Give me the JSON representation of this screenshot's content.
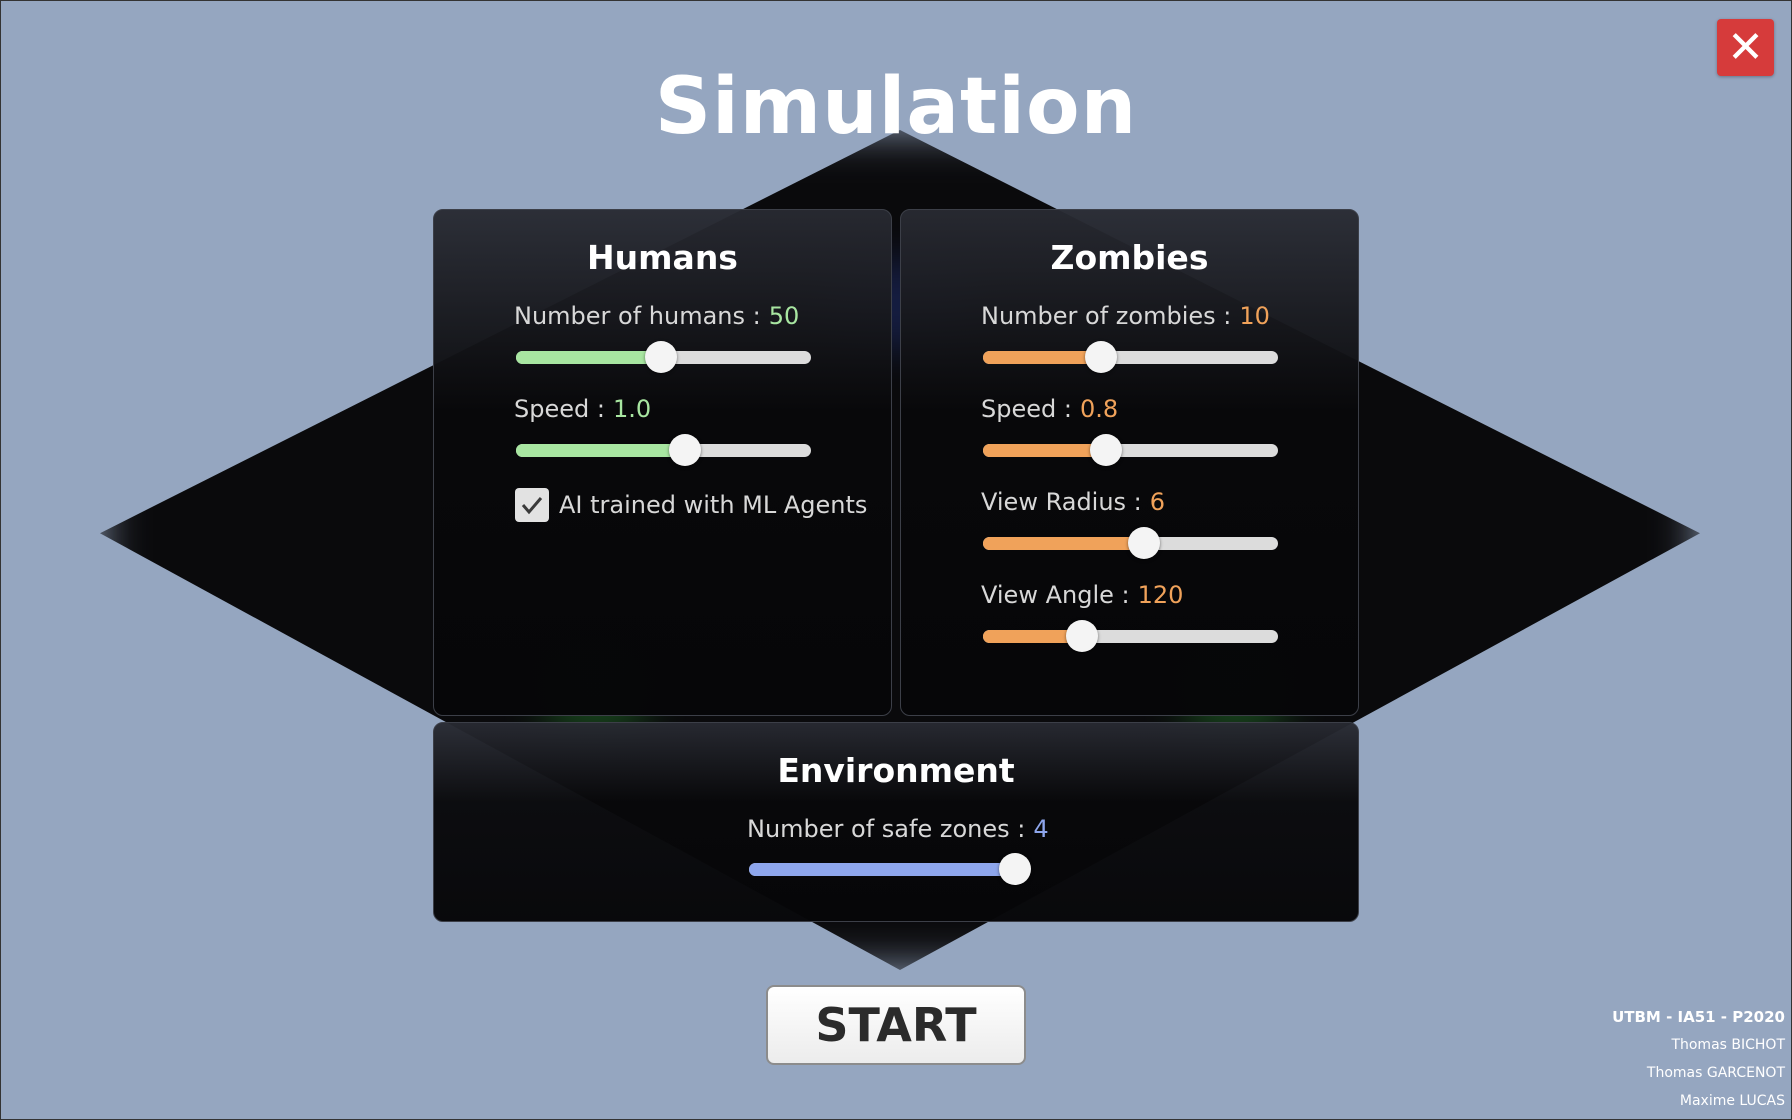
{
  "title": "Simulation",
  "close_icon_glyph": "✕",
  "colors": {
    "humans_accent": "#a8e6a1",
    "zombies_accent": "#f0a25a",
    "environment_accent": "#8ea6ec",
    "close_red": "#d63b3b"
  },
  "humans": {
    "heading": "Humans",
    "number_label": "Number of humans :",
    "number_value": "50",
    "number_fraction": 0.49,
    "speed_label": "Speed :",
    "speed_value": "1.0",
    "speed_fraction": 0.58,
    "ai_label": "AI trained with ML Agents",
    "ai_checked": true
  },
  "zombies": {
    "heading": "Zombies",
    "number_label": "Number of zombies :",
    "number_value": "10",
    "number_fraction": 0.39,
    "speed_label": "Speed :",
    "speed_value": "0.8",
    "speed_fraction": 0.41,
    "radius_label": "View Radius :",
    "radius_value": "6",
    "radius_fraction": 0.55,
    "angle_label": "View Angle :",
    "angle_value": "120",
    "angle_fraction": 0.32
  },
  "environment": {
    "heading": "Environment",
    "zones_label": "Number of safe zones :",
    "zones_value": "4",
    "zones_fraction": 1.0
  },
  "start_label": "START",
  "credits": {
    "org": "UTBM - IA51 - P2020",
    "authors": [
      "Thomas BICHOT",
      "Thomas GARCENOT",
      "Maxime LUCAS"
    ]
  }
}
